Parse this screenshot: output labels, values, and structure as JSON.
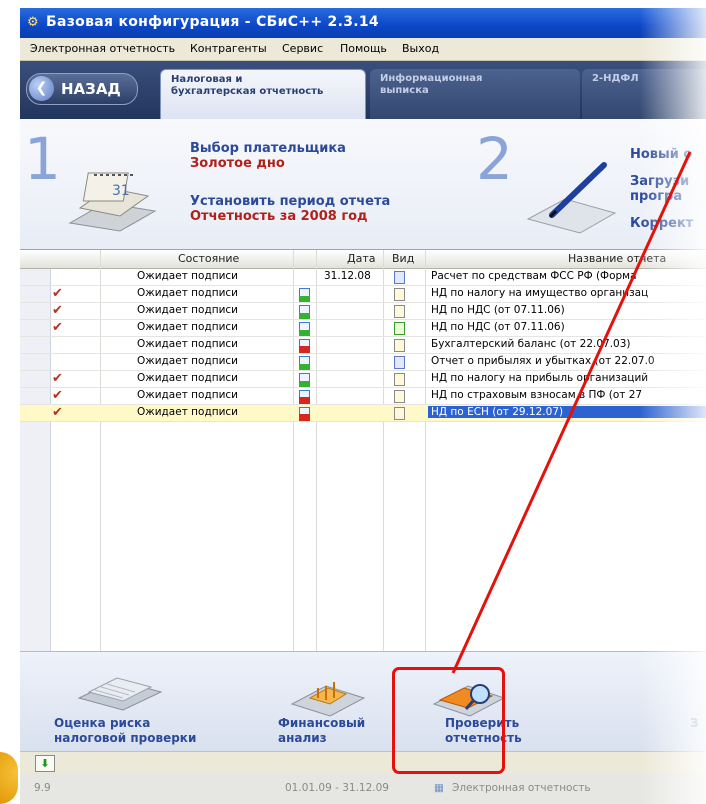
{
  "window": {
    "title": "Базовая конфигурация - СБиС++ 2.3.14"
  },
  "menu": [
    "Электронная отчетность",
    "Контрагенты",
    "Сервис",
    "Помощь",
    "Выход"
  ],
  "nav": {
    "back_label": "НАЗАД",
    "tabs": [
      {
        "line1": "Налоговая и",
        "line2": "бухгалтерская отчетность"
      },
      {
        "line1": "Информационная",
        "line2": "выписка"
      },
      {
        "line1": "2-НДФЛ",
        "line2": ""
      }
    ]
  },
  "banner": {
    "step1": "1",
    "step2": "2",
    "payer_label": "Выбор плательщика",
    "payer_value": "Золотое дно",
    "period_label": "Установить период отчета",
    "period_value": "Отчетность за 2008 год",
    "right1": "Новый о",
    "right2a": "Загрузи",
    "right2b": "програ",
    "right3": "Коррект"
  },
  "table": {
    "headers": {
      "state": "Состояние",
      "date": "Дата",
      "kind": "Вид",
      "name": "Название отчета"
    },
    "rows": [
      {
        "checked": false,
        "state": "Ожидает подписи",
        "status": "",
        "date": "31.12.08",
        "doc": "blue",
        "name": "Расчет по средствам ФСС РФ (Форма",
        "selected": false
      },
      {
        "checked": true,
        "state": "Ожидает подписи",
        "status": "green",
        "date": "",
        "doc": "yellow",
        "name": "НД по налогу на имущество организац",
        "selected": false
      },
      {
        "checked": true,
        "state": "Ожидает подписи",
        "status": "green",
        "date": "",
        "doc": "yellow",
        "name": "НД по НДС (от 07.11.06)",
        "selected": false
      },
      {
        "checked": true,
        "state": "Ожидает подписи",
        "status": "green",
        "date": "",
        "doc": "green",
        "name": "НД по НДС (от 07.11.06)",
        "selected": false
      },
      {
        "checked": false,
        "state": "Ожидает подписи",
        "status": "red",
        "date": "",
        "doc": "yellow",
        "name": "Бухгалтерский баланс (от 22.07.03)",
        "selected": false
      },
      {
        "checked": false,
        "state": "Ожидает подписи",
        "status": "green",
        "date": "",
        "doc": "blue",
        "name": "Отчет о прибылях и убытках (от 22.07.0",
        "selected": false
      },
      {
        "checked": true,
        "state": "Ожидает подписи",
        "status": "green",
        "date": "",
        "doc": "yellow",
        "name": "НД по налогу на прибыль организаций",
        "selected": false
      },
      {
        "checked": true,
        "state": "Ожидает подписи",
        "status": "red",
        "date": "",
        "doc": "yellow",
        "name": "НД по страховым взносам в ПФ (от 27",
        "selected": false
      },
      {
        "checked": true,
        "state": "Ожидает подписи",
        "status": "red",
        "date": "",
        "doc": "yellow",
        "name": "НД по ЕСН (от 29.12.07)",
        "selected": true
      }
    ]
  },
  "tools": {
    "risk_line1": "Оценка риска",
    "risk_line2": "налоговой проверки",
    "fin_line1": "Финансовый",
    "fin_line2": "анализ",
    "check_line1": "Проверить",
    "check_line2": "отчетность",
    "extra": "З"
  },
  "status": {
    "left": "9.9",
    "period": "01.01.09 - 31.12.09",
    "mode": "Электронная отчетность"
  },
  "colors": {
    "titlebar": "#0c47c7",
    "nav": "#22355d",
    "link": "#2c4a9a",
    "accent_red": "#b0211b",
    "highlight": "#e4110c",
    "selection": "#2d63d1"
  }
}
